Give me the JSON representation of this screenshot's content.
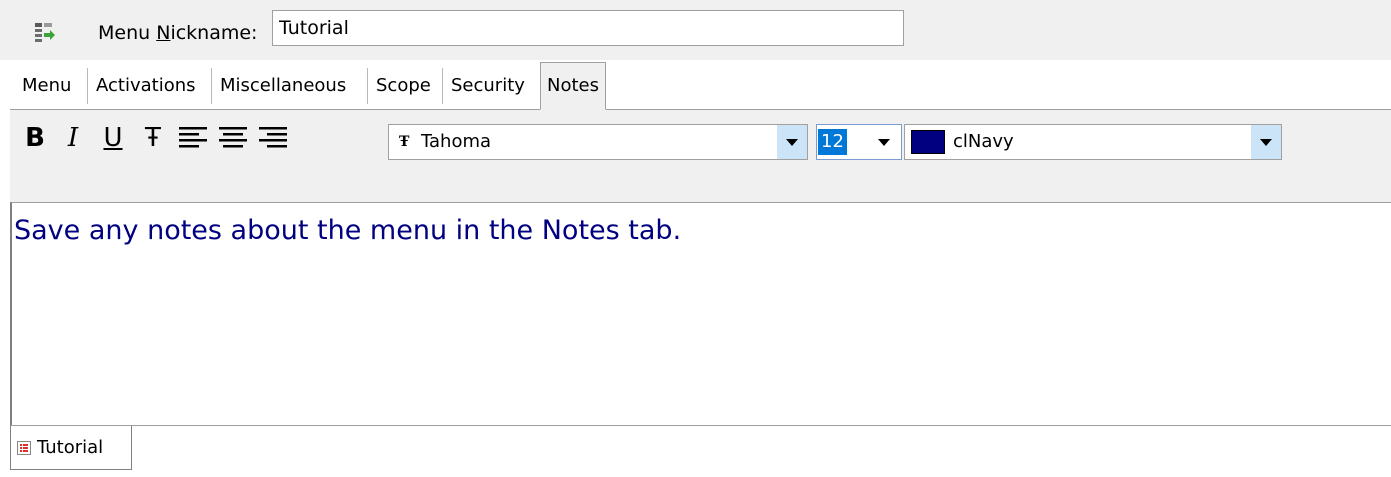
{
  "header": {
    "app_icon": "menu-export-icon",
    "nickname_label_pre": "Menu ",
    "nickname_label_accel": "N",
    "nickname_label_post": "ickname:",
    "nickname_value": "Tutorial"
  },
  "tabs": [
    {
      "label": "Menu"
    },
    {
      "label": "Activations"
    },
    {
      "label": "Miscellaneous"
    },
    {
      "label": "Scope"
    },
    {
      "label": "Security"
    },
    {
      "label": "Notes",
      "active": true
    }
  ],
  "toolbar": {
    "bold_label": "B",
    "italic_label": "I",
    "underline_label": "U",
    "strike_label": "Ŧ",
    "font_icon": "truetype-font-icon",
    "font_glyph": "Ŧ",
    "font_name": "Tahoma",
    "font_size": "12",
    "color_name": "clNavy",
    "color_hex": "#000080"
  },
  "editor": {
    "text": "Save any notes about the menu in the Notes tab.",
    "text_color": "#000080"
  },
  "document_tabs": [
    {
      "label": "Tutorial",
      "icon": "menu-doc-icon"
    }
  ]
}
